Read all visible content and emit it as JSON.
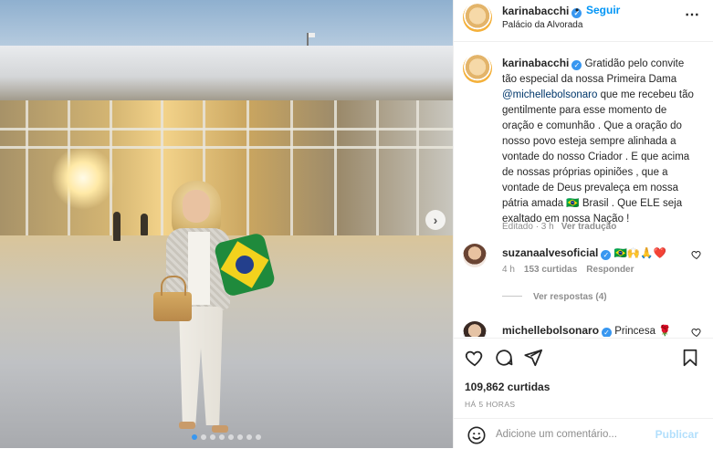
{
  "post": {
    "username": "karinabacchi",
    "follow_label": "Seguir",
    "separator": "•",
    "location": "Palácio da Alvorada",
    "more_icon": "⋯",
    "verified_icon": "✓"
  },
  "caption": {
    "username": "karinabacchi",
    "text_before": " Gratidão pelo convite tão especial da nossa Primeira Dama ",
    "mention": "@michellebolsonaro",
    "text_after": " que me recebeu tão gentilmente para esse momento de oração e comunhão . Que a oração do nosso povo esteja sempre alinhada a vontade do nosso Criador . E que acima de nossas próprias opiniões , que a vontade de Deus prevaleça em nossa pátria amada 🇧🇷 Brasil . Que ELE seja exaltado em nossa Nação !",
    "meta": "Editado · 3 h",
    "translate": "Ver tradução"
  },
  "comments": [
    {
      "username": "suzanaalvesoficial",
      "text": " 🇧🇷🙌🙏❤️",
      "time": "4 h",
      "likes": "153 curtidas",
      "reply": "Responder"
    },
    {
      "username": "michellebolsonaro",
      "text": " Princesa 🌹"
    }
  ],
  "replies_label": "Ver respostas (4)",
  "actions": {
    "likes": "109,862 curtidas",
    "time": "HÁ 5 HORAS"
  },
  "add_comment": {
    "placeholder": "Adicione um comentário...",
    "publish": "Publicar"
  },
  "carousel": {
    "next_icon": "›",
    "dots": 8,
    "active_index": 0
  },
  "colors": {
    "accent": "#0095f6",
    "verified": "#3897f0",
    "heart": "#ed4956"
  }
}
